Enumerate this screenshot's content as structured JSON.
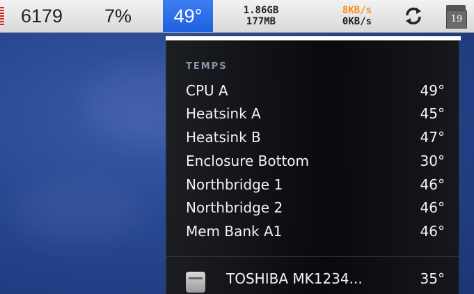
{
  "menubar": {
    "cpu_count": "6179",
    "cpu_percent": "7%",
    "temperature": "49°",
    "memory_used": "1.86GB",
    "memory_free": "177MB",
    "net_down": "8KB/s",
    "net_up": "0KB/s",
    "calendar_day": "19"
  },
  "dropdown": {
    "section_title": "TEMPS",
    "sensors": [
      {
        "label": "CPU A",
        "value": "49°"
      },
      {
        "label": "Heatsink A",
        "value": "45°"
      },
      {
        "label": "Heatsink B",
        "value": "47°"
      },
      {
        "label": "Enclosure Bottom",
        "value": "30°"
      },
      {
        "label": "Northbridge 1",
        "value": "46°"
      },
      {
        "label": "Northbridge 2",
        "value": "46°"
      },
      {
        "label": "Mem Bank A1",
        "value": "46°"
      }
    ],
    "disk": {
      "name": "TOSHIBA MK1234...",
      "value": "35°"
    }
  },
  "colors": {
    "accent_blue": "#2a6ff0",
    "cpu_red": "#e0201a",
    "net_orange": "#ff8a1e"
  },
  "icons": {
    "refresh": "refresh-icon",
    "calendar": "calendar-icon",
    "disk": "hard-disk-icon"
  }
}
